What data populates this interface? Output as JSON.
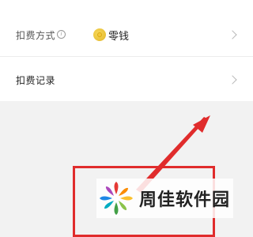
{
  "payment_method": {
    "label": "扣费方式",
    "info_icon_glyph": "i",
    "value": "零钱",
    "icon": "coin-icon"
  },
  "deduction_record": {
    "label": "扣费记录"
  },
  "annotation": {
    "color": "#e02c2c"
  },
  "watermark": {
    "text": "周佳软件园"
  }
}
